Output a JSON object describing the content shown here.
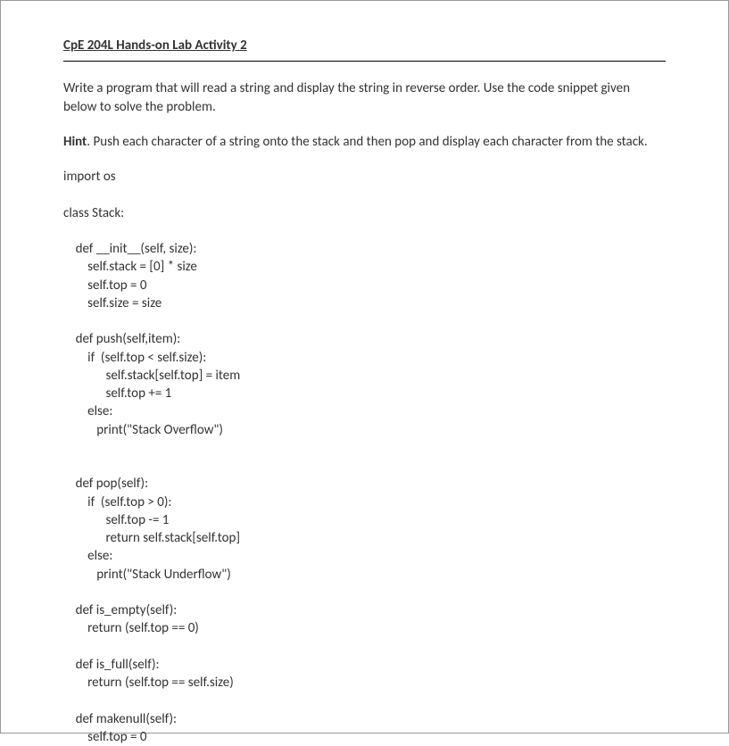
{
  "header": "CpE 204L Hands-on Lab Activity 2",
  "intro": "Write a program that will read a string and display the string in reverse order.   Use the code snippet given below to solve the problem.",
  "hint_label": "Hint",
  "hint_text": ".   Push each character of a string onto the stack and then pop and display each character from the stack.",
  "code": "import os\n\nclass Stack:\n\n    def __init__(self, size):\n        self.stack = [0] * size\n        self.top = 0\n        self.size = size\n\n    def push(self,item):\n        if  (self.top < self.size):\n              self.stack[self.top] = item\n              self.top += 1\n        else:\n           print(\"Stack Overflow\")\n\n\n    def pop(self):\n        if  (self.top > 0):\n              self.top -= 1\n              return self.stack[self.top]\n        else:\n           print(\"Stack Underflow\")\n\n    def is_empty(self):\n        return (self.top == 0)\n\n    def is_full(self):\n        return (self.top == self.size)\n\n    def makenull(self):\n        self.top = 0"
}
